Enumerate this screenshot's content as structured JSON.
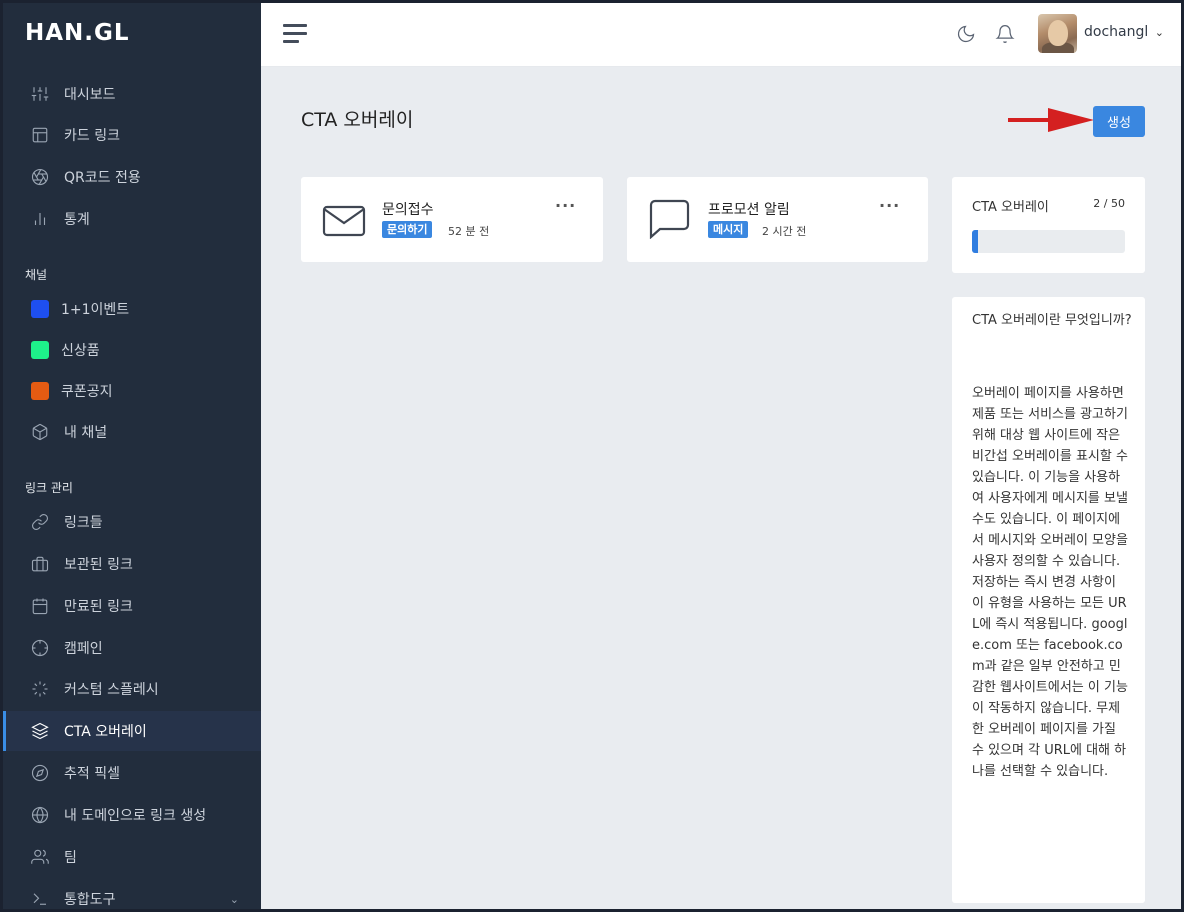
{
  "brand": {
    "logo": "HAN.GL"
  },
  "sidebar": {
    "items": [
      {
        "label": "대시보드",
        "icon": "sliders-icon"
      },
      {
        "label": "카드 링크",
        "icon": "layout-icon"
      },
      {
        "label": "QR코드 전용",
        "icon": "aperture-icon"
      },
      {
        "label": "통계",
        "icon": "bar-chart-icon"
      }
    ],
    "channel_heading": "채널",
    "channels": [
      {
        "label": "1+1이벤트",
        "color": "#1e4ff0"
      },
      {
        "label": "신상품",
        "color": "#1ef08a"
      },
      {
        "label": "쿠폰공지",
        "color": "#e55b12"
      },
      {
        "label": "내 채널",
        "icon": "box-icon"
      }
    ],
    "links_heading": "링크 관리",
    "links": [
      {
        "label": "링크들",
        "icon": "link-icon"
      },
      {
        "label": "보관된 링크",
        "icon": "briefcase-icon"
      },
      {
        "label": "만료된 링크",
        "icon": "calendar-icon"
      },
      {
        "label": "캠페인",
        "icon": "crosshair-icon"
      },
      {
        "label": "커스텀 스플레시",
        "icon": "loader-icon"
      },
      {
        "label": "CTA 오버레이",
        "icon": "layers-icon",
        "active": true
      },
      {
        "label": "추적 픽셀",
        "icon": "compass-icon"
      },
      {
        "label": "내 도메인으로 링크 생성",
        "icon": "globe-icon"
      },
      {
        "label": "팀",
        "icon": "users-icon"
      },
      {
        "label": "통합도구",
        "icon": "terminal-icon"
      }
    ]
  },
  "topbar": {
    "username": "dochangl"
  },
  "main": {
    "title": "CTA 오버레이",
    "create_label": "생성",
    "cards": [
      {
        "title": "문의접수",
        "badge": "문의하기",
        "time": "52 분 전",
        "icon": "mail-icon"
      },
      {
        "title": "프로모션 알림",
        "badge": "메시지",
        "time": "2 시간 전",
        "icon": "message-square-icon"
      }
    ],
    "stat": {
      "title": "CTA 오버레이",
      "count": "2 / 50",
      "progress": 0.04
    },
    "info": {
      "question": "CTA 오버레이란 무엇입니까?",
      "body": "오버레이 페이지를 사용하면 제품 또는 서비스를 광고하기 위해 대상 웹 사이트에 작은 비간섭 오버레이를 표시할 수 있습니다. 이 기능을 사용하여 사용자에게 메시지를 보낼 수도 있습니다. 이 페이지에서 메시지와 오버레이 모양을 사용자 정의할 수 있습니다. 저장하는 즉시 변경 사항이 이 유형을 사용하는 모든 URL에 즉시 적용됩니다. google.com 또는 facebook.com과 같은 일부 안전하고 민감한 웹사이트에서는 이 기능이 작동하지 않습니다. 무제한 오버레이 페이지를 가질 수 있으며 각 URL에 대해 하나를 선택할 수 있습니다."
    }
  }
}
